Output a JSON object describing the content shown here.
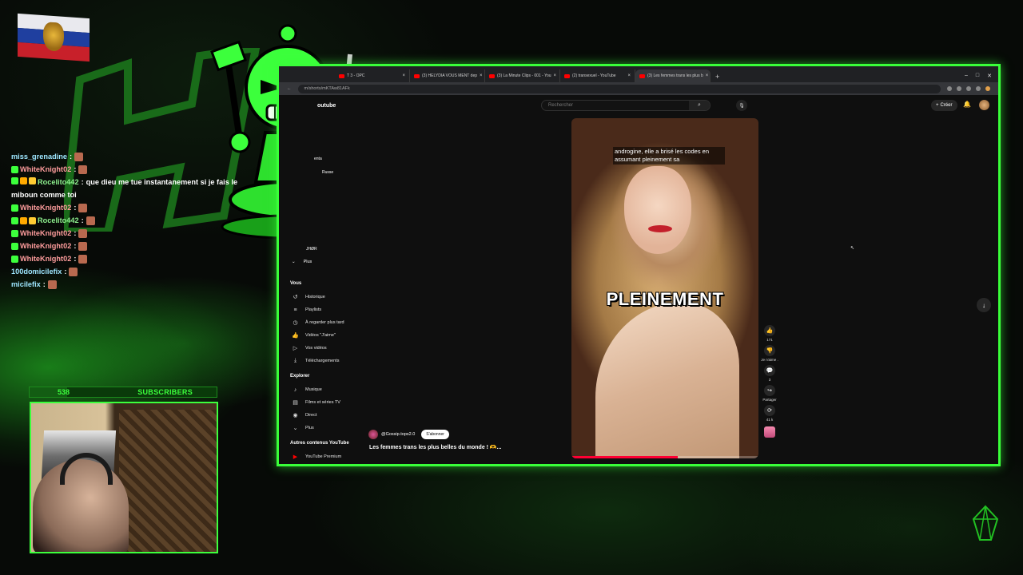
{
  "chat": [
    {
      "user": "miss_grenadine",
      "sep": ":",
      "msg": "",
      "user_color": "cyan",
      "emote": true,
      "badges": 0
    },
    {
      "user": "WhiteKnight02",
      "sep": ":",
      "msg": "",
      "user_color": "white",
      "emote": true,
      "badges": 1
    },
    {
      "user": "Rocelito442",
      "sep": ":",
      "msg": "que dieu me tue instantanement si je fais le miboun comme toi",
      "user_color": "green",
      "emote": false,
      "badges": 3
    },
    {
      "user": "WhiteKnight02",
      "sep": ":",
      "msg": "",
      "user_color": "white",
      "emote": true,
      "badges": 1
    },
    {
      "user": "Rocelito442",
      "sep": ":",
      "msg": "",
      "user_color": "green",
      "emote": true,
      "badges": 3
    },
    {
      "user": "WhiteKnight02",
      "sep": ":",
      "msg": "",
      "user_color": "white",
      "emote": true,
      "badges": 1
    },
    {
      "user": "WhiteKnight02",
      "sep": ":",
      "msg": "",
      "user_color": "white",
      "emote": true,
      "badges": 1
    },
    {
      "user": "WhiteKnight02",
      "sep": ":",
      "msg": "",
      "user_color": "white",
      "emote": true,
      "badges": 1
    },
    {
      "user": "100domicilefix",
      "sep": ":",
      "msg": "",
      "user_color": "cyan",
      "emote": true,
      "badges": 0
    },
    {
      "user": "micilefix",
      "sep": ":",
      "msg": "",
      "user_color": "cyan",
      "emote": true,
      "badges": 0
    }
  ],
  "subscribers": {
    "count": "538",
    "label": "SUBSCRIBERS",
    "goal_fraction": 0.2
  },
  "browser": {
    "tabs": [
      {
        "label": "T 3 - OPC",
        "active": false
      },
      {
        "label": "(3) HELYDIA VOUS MENT dep",
        "active": false
      },
      {
        "label": "(3) La Minute Clips - 001 - You",
        "active": false
      },
      {
        "label": "(2) transexuel - YouTube",
        "active": false
      },
      {
        "label": "(3) Les femmes trans les plus b",
        "active": true
      }
    ],
    "new_tab": "+",
    "window_controls": [
      "–",
      "□",
      "✕"
    ],
    "url": "m/shorts/mKTAw81AFk"
  },
  "youtube": {
    "search_placeholder": "Rechercher",
    "search_icon": "search-icon",
    "mic_icon": "mic-icon",
    "create_label": "Créer",
    "sidebar": {
      "partial_items": [
        "outube",
        "enta",
        "Russe",
        "JHØR",
        "Plus"
      ],
      "you_section": "Vous",
      "you_items": [
        {
          "icon": "history-icon",
          "glyph": "↺",
          "label": "Historique"
        },
        {
          "icon": "playlist-icon",
          "glyph": "≡",
          "label": "Playlists"
        },
        {
          "icon": "clock-icon",
          "glyph": "◷",
          "label": "À regarder plus tard"
        },
        {
          "icon": "thumb-up-icon",
          "glyph": "👍",
          "label": "Vidéos \"J'aime\""
        },
        {
          "icon": "video-icon",
          "glyph": "▷",
          "label": "Vos vidéos"
        },
        {
          "icon": "download-icon",
          "glyph": "⤓",
          "label": "Téléchargements"
        }
      ],
      "explore_section": "Explorer",
      "explore_items": [
        {
          "icon": "music-icon",
          "glyph": "♪",
          "label": "Musique"
        },
        {
          "icon": "film-icon",
          "glyph": "▤",
          "label": "Films et séries TV"
        },
        {
          "icon": "live-icon",
          "glyph": "◉",
          "label": "Direct"
        },
        {
          "icon": "chevron-down-icon",
          "glyph": "⌄",
          "label": "Plus"
        }
      ],
      "other_section": "Autres contenus YouTube",
      "other_items": [
        {
          "icon": "youtube-premium-icon",
          "glyph": "▶",
          "label": "YouTube Premium"
        }
      ]
    },
    "short": {
      "caption": "androgine, elle a brisé les codes en assumant pleinement sa",
      "overlay_word": "PLEINEMENT",
      "progress": 0.57,
      "channel": "@Gossip.tops2.0",
      "subscribe": "S'abonner",
      "title": "Les femmes trans les plus belles du monde ! 🫶..."
    },
    "actions": [
      {
        "name": "like-button",
        "glyph": "👍",
        "label": "171"
      },
      {
        "name": "dislike-button",
        "glyph": "👎",
        "label": "Je n'aime ."
      },
      {
        "name": "comments-button",
        "glyph": "💬",
        "label": "3"
      },
      {
        "name": "share-button",
        "glyph": "↪",
        "label": "Partager"
      },
      {
        "name": "remix-button",
        "glyph": "⟳",
        "label": "41 k"
      }
    ],
    "next_icon": "↓"
  }
}
